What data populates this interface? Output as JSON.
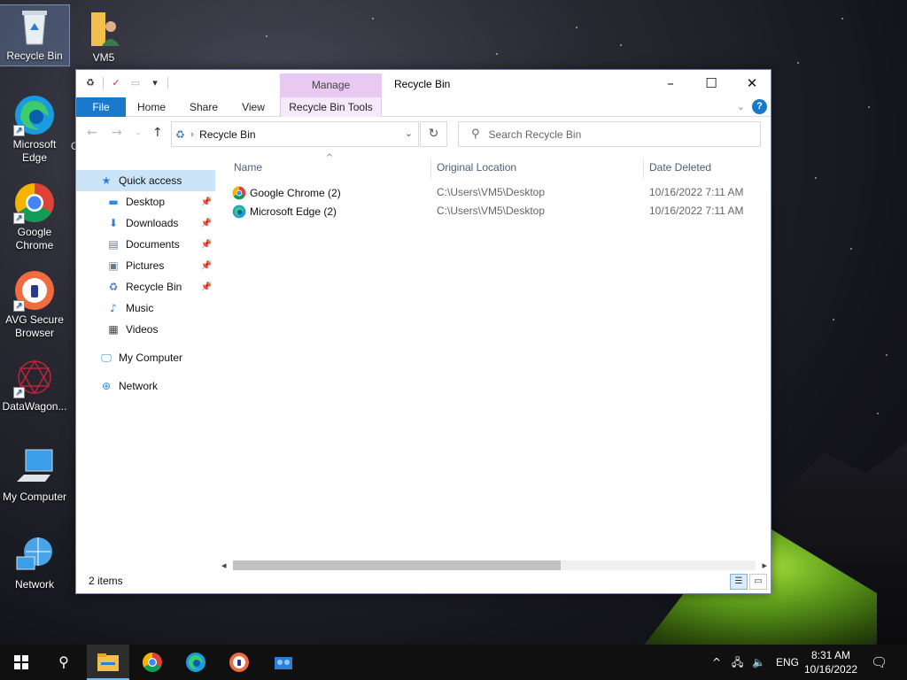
{
  "desktop": {
    "icons": [
      {
        "label": "Recycle Bin",
        "icon": "recycle-bin-icon"
      },
      {
        "label": "VM5",
        "icon": "user-folder-icon"
      },
      {
        "label": "Microsoft Edge",
        "icon": "edge-icon"
      },
      {
        "label": "Google Chrome",
        "icon": "chrome-icon"
      },
      {
        "label": "AVG Secure Browser",
        "icon": "avg-browser-icon"
      },
      {
        "label": "DataWagon...",
        "icon": "datawagon-icon"
      },
      {
        "label": "My Computer",
        "icon": "computer-icon"
      },
      {
        "label": "Network",
        "icon": "network-icon"
      }
    ],
    "partial_label": "C"
  },
  "window": {
    "title": "Recycle Bin",
    "manage_tab": "Manage",
    "ribbon_tabs": [
      "File",
      "Home",
      "Share",
      "View",
      "Recycle Bin Tools"
    ],
    "help": "?",
    "address": {
      "crumb": "Recycle Bin"
    },
    "search_placeholder": "Search Recycle Bin",
    "navpane": {
      "quick_access": "Quick access",
      "items": [
        {
          "label": "Desktop",
          "icon": "desktop-icon",
          "pinned": true
        },
        {
          "label": "Downloads",
          "icon": "downloads-icon",
          "pinned": true
        },
        {
          "label": "Documents",
          "icon": "documents-icon",
          "pinned": true
        },
        {
          "label": "Pictures",
          "icon": "pictures-icon",
          "pinned": true
        },
        {
          "label": "Recycle Bin",
          "icon": "recycle-bin-icon",
          "pinned": true
        },
        {
          "label": "Music",
          "icon": "music-icon",
          "pinned": false
        },
        {
          "label": "Videos",
          "icon": "videos-icon",
          "pinned": false
        }
      ],
      "my_computer": "My Computer",
      "network": "Network"
    },
    "columns": [
      "Name",
      "Original Location",
      "Date Deleted"
    ],
    "rows": [
      {
        "name": "Google Chrome (2)",
        "location": "C:\\Users\\VM5\\Desktop",
        "date": "10/16/2022 7:11 AM",
        "icon": "chrome-icon"
      },
      {
        "name": "Microsoft Edge (2)",
        "location": "C:\\Users\\VM5\\Desktop",
        "date": "10/16/2022 7:11 AM",
        "icon": "edge-icon"
      }
    ],
    "status": "2 items"
  },
  "taskbar": {
    "apps": [
      "start-icon",
      "search-icon",
      "file-explorer-icon",
      "chrome-icon",
      "edge-icon",
      "avg-browser-icon",
      "datawagon-icon"
    ],
    "lang": "ENG",
    "time": "8:31 AM",
    "date": "10/16/2022"
  },
  "colors": {
    "accent": "#1979ca",
    "manage": "#e8c9f2",
    "selection": "#cce4f7"
  }
}
